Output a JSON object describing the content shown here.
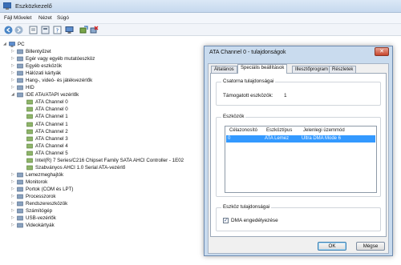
{
  "window": {
    "title": "Eszközkezelő"
  },
  "menu": [
    "Fájl",
    "Művelet",
    "Nézet",
    "Súgó"
  ],
  "toolbar": [
    "back-icon",
    "forward-icon",
    "properties-icon",
    "tree-view-icon",
    "help-icon",
    "computer-icon",
    "update-driver-icon",
    "uninstall-icon"
  ],
  "tree": {
    "root": "PC",
    "items": [
      {
        "label": "Billentyűzet",
        "icon": "keyboard-icon",
        "indent": 1,
        "expanded": false
      },
      {
        "label": "Egér vagy egyéb mutatóeszköz",
        "icon": "mouse-icon",
        "indent": 1,
        "expanded": false
      },
      {
        "label": "Egyéb eszközök",
        "icon": "other-devices-icon",
        "indent": 1,
        "expanded": false
      },
      {
        "label": "Hálózati kártyák",
        "icon": "network-icon",
        "indent": 1,
        "expanded": false
      },
      {
        "label": "Hang-, videó- és játékvezérlők",
        "icon": "sound-icon",
        "indent": 1,
        "expanded": false
      },
      {
        "label": "HID",
        "icon": "hid-icon",
        "indent": 1,
        "expanded": false
      },
      {
        "label": "IDE ATA/ATAPI vezérlők",
        "icon": "ide-controller-icon",
        "indent": 1,
        "expanded": true
      },
      {
        "label": "ATA Channel 0",
        "icon": "ide-channel-icon",
        "indent": 2,
        "expanded": null
      },
      {
        "label": "ATA Channel 0",
        "icon": "ide-channel-icon",
        "indent": 2,
        "expanded": null
      },
      {
        "label": "ATA Channel 1",
        "icon": "ide-channel-icon",
        "indent": 2,
        "expanded": null
      },
      {
        "label": "ATA Channel 1",
        "icon": "ide-channel-icon",
        "indent": 2,
        "expanded": null
      },
      {
        "label": "ATA Channel 2",
        "icon": "ide-channel-icon",
        "indent": 2,
        "expanded": null
      },
      {
        "label": "ATA Channel 3",
        "icon": "ide-channel-icon",
        "indent": 2,
        "expanded": null
      },
      {
        "label": "ATA Channel 4",
        "icon": "ide-channel-icon",
        "indent": 2,
        "expanded": null
      },
      {
        "label": "ATA Channel 5",
        "icon": "ide-channel-icon",
        "indent": 2,
        "expanded": null
      },
      {
        "label": "Intel(R) 7 Series/C216 Chipset Family SATA AHCI Controller - 1E02",
        "icon": "ide-channel-icon",
        "indent": 2,
        "expanded": null
      },
      {
        "label": "Szabványos AHCI 1.0 Serial ATA-vezérlő",
        "icon": "ide-channel-icon",
        "indent": 2,
        "expanded": null
      },
      {
        "label": "Lemezmeghajtók",
        "icon": "disk-drive-icon",
        "indent": 1,
        "expanded": false
      },
      {
        "label": "Monitorok",
        "icon": "monitor-icon",
        "indent": 1,
        "expanded": false
      },
      {
        "label": "Portok (COM és LPT)",
        "icon": "port-icon",
        "indent": 1,
        "expanded": false
      },
      {
        "label": "Processzorok",
        "icon": "processor-icon",
        "indent": 1,
        "expanded": false
      },
      {
        "label": "Rendszereszközök",
        "icon": "system-devices-icon",
        "indent": 1,
        "expanded": false
      },
      {
        "label": "Számítógép",
        "icon": "computer-icon",
        "indent": 1,
        "expanded": false
      },
      {
        "label": "USB-vezérlők",
        "icon": "usb-icon",
        "indent": 1,
        "expanded": false
      },
      {
        "label": "Videokártyák",
        "icon": "display-adapter-icon",
        "indent": 1,
        "expanded": false
      }
    ]
  },
  "dialog": {
    "title": "ATA Channel 0 - tulajdonságok",
    "close": "✕",
    "tabs": [
      "Általános",
      "Speciális beállítások",
      "Illesztőprogram",
      "Részletek"
    ],
    "active_tab": 1,
    "channel_group": {
      "title": "Csatorna tulajdonságai",
      "label": "Támogatott eszközök:",
      "value": "1"
    },
    "devices_group": {
      "title": "Eszközök",
      "columns": [
        "Célazonosító",
        "Eszköztípus",
        "Jelenlegi üzemmód"
      ],
      "rows": [
        {
          "target": "0",
          "type": "ATA Lemez",
          "mode": "Ultra DMA Mode 6",
          "selected": true
        }
      ]
    },
    "device_props_group": {
      "title": "Eszköz tulajdonságai",
      "dma_label": "DMA engedélyezése",
      "dma_checked": true,
      "check": "✓"
    },
    "ok": "OK",
    "cancel": "Mégse"
  },
  "colors": {
    "selection": "#3399ff",
    "titlebar": "#c6d9ee"
  }
}
